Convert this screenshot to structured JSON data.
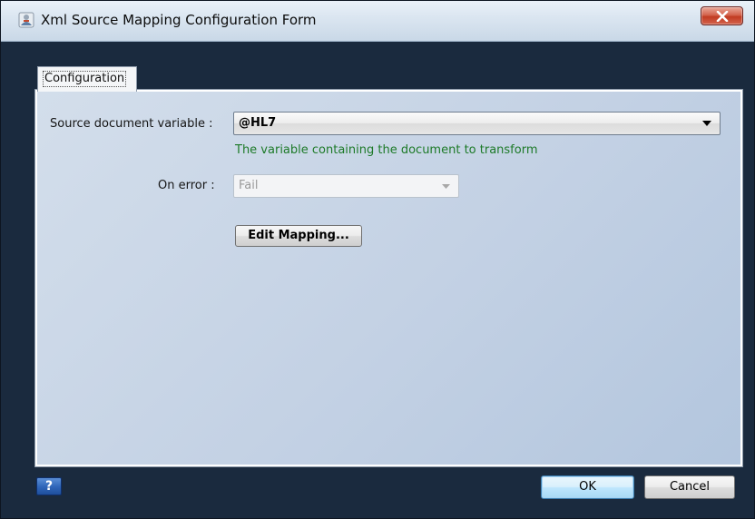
{
  "window": {
    "title": "Xml Source Mapping Configuration Form"
  },
  "tabs": [
    {
      "label": "Configuration",
      "selected": true
    }
  ],
  "form": {
    "source_label": "Source document variable :",
    "source_value": "@HL7",
    "source_hint": "The variable containing the document to transform",
    "error_label": "On error :",
    "error_value": "Fail",
    "error_enabled": false,
    "edit_mapping_label": "Edit Mapping..."
  },
  "footer": {
    "help_label": "?",
    "ok_label": "OK",
    "cancel_label": "Cancel"
  },
  "colors": {
    "frame": "#1a2a3e",
    "panel": "#c3d1e4",
    "hint": "#1d7a28",
    "close_button": "#c13b22"
  },
  "icons": {
    "title": "app-form-icon",
    "close": "close-icon",
    "dropdown": "chevron-down-icon",
    "help": "help-icon"
  }
}
